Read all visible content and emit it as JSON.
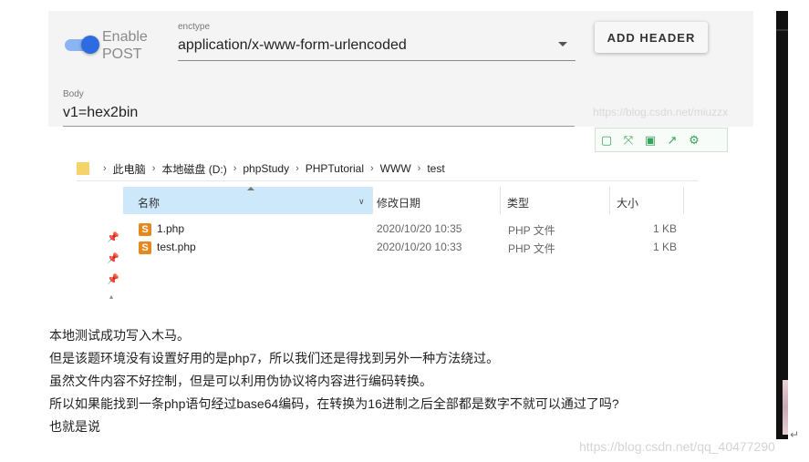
{
  "request": {
    "toggle_label": "Enable POST",
    "toggle_line1": "Enable",
    "toggle_line2": "POST",
    "toggle_on": true,
    "enctype_caption": "enctype",
    "enctype_value": "application/x-www-form-urlencoded",
    "add_header_label": "ADD HEADER",
    "body_caption": "Body",
    "body_value": "v1=hex2bin",
    "accent_color": "#2d6be0"
  },
  "watermark_top": "https://blog.csdn.net/miuzzx",
  "toolbar_icons": [
    "copy-icon",
    "expand-icon",
    "save-icon",
    "share-icon",
    "settings-icon"
  ],
  "toolbar_glyphs": [
    "▢",
    "⤧",
    "▣",
    "↗",
    "⚙"
  ],
  "explorer": {
    "breadcrumb": [
      "此电脑",
      "本地磁盘 (D:)",
      "phpStudy",
      "PHPTutorial",
      "WWW",
      "test"
    ],
    "columns": {
      "name": "名称",
      "date": "修改日期",
      "type": "类型",
      "size": "大小"
    },
    "files": [
      {
        "name": "1.php",
        "date": "2020/10/20 10:35",
        "type": "PHP 文件",
        "size": "1 KB"
      },
      {
        "name": "test.php",
        "date": "2020/10/20 10:33",
        "type": "PHP 文件",
        "size": "1 KB"
      }
    ]
  },
  "article": {
    "lines": [
      "本地测试成功写入木马。",
      "但是该题环境没有设置好用的是php7，所以我们还是得找到另外一种方法绕过。",
      "虽然文件内容不好控制，但是可以利用伪协议将内容进行编码转换。",
      "所以如果能找到一条php语句经过base64编码，在转换为16进制之后全部都是数字不就可以通过了吗?",
      "也就是说"
    ]
  },
  "watermark_bottom": "https://blog.csdn.net/qq_40477290"
}
